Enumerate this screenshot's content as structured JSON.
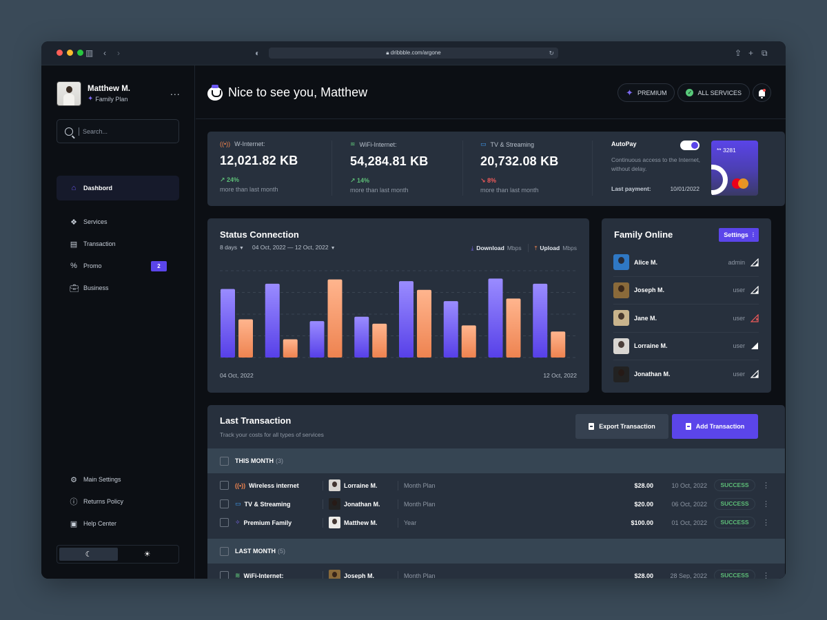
{
  "browser": {
    "url": "dribbble.com/argone",
    "dot_colors": [
      "#ff5f57",
      "#febc2e",
      "#28c840"
    ]
  },
  "sidebar": {
    "profile": {
      "name": "Matthew M.",
      "plan": "Family Plan",
      "more": "..."
    },
    "search": {
      "placeholder": "Search..."
    },
    "nav": [
      {
        "label": "Dashbord",
        "icon": "home-icon",
        "active": true
      },
      {
        "label": "Services",
        "icon": "services-icon"
      },
      {
        "label": "Transaction",
        "icon": "transaction-icon"
      },
      {
        "label": "Promo",
        "icon": "percent-icon",
        "badge": "2"
      },
      {
        "label": "Business",
        "icon": "briefcase-icon"
      }
    ],
    "bottom_nav": [
      {
        "label": "Main Settings",
        "icon": "gear-icon"
      },
      {
        "label": "Returns Policy",
        "icon": "info-icon"
      },
      {
        "label": "Help Center",
        "icon": "help-icon"
      }
    ],
    "theme": {
      "active": "dark"
    }
  },
  "header": {
    "greeting": "Nice to see you, Matthew",
    "premium": "PREMIUM",
    "all_services": "ALL SERVICES"
  },
  "stats": [
    {
      "label": "W-Internet:",
      "value": "12,021.82 KB",
      "change": "24%",
      "direction": "up",
      "sub": "more than last month",
      "icon": "wireless-icon"
    },
    {
      "label": "WiFi-Internet:",
      "value": "54,284.81 KB",
      "change": "14%",
      "direction": "up",
      "sub": "more than last month",
      "icon": "wifi-icon"
    },
    {
      "label": "TV & Streaming",
      "value": "20,732.08 KB",
      "change": "8%",
      "direction": "down",
      "sub": "more than last month",
      "icon": "tv-icon"
    }
  ],
  "autopay": {
    "title": "AutoPay",
    "enabled": true,
    "description": "Continuous access to the Internet, without delay.",
    "last_payment_label": "Last payment:",
    "last_payment_value": "10/01/2022",
    "card_number": "** 3281"
  },
  "status_connection": {
    "title": "Status Connection",
    "period": "8 days",
    "range": "04 Oct, 2022 — 12 Oct, 2022",
    "legend_download": "Download",
    "legend_upload": "Upload",
    "unit": "Mbps"
  },
  "chart_data": {
    "type": "bar",
    "title": "Status Connection",
    "xlabel": "",
    "ylabel": "Mbps",
    "x_start_label": "04 Oct, 2022",
    "x_end_label": "12 Oct, 2022",
    "ylim": [
      0,
      100
    ],
    "grid": true,
    "categories": [
      "1",
      "2",
      "3",
      "4",
      "5",
      "6",
      "7",
      "8"
    ],
    "series": [
      {
        "name": "Download Mbps",
        "color": "#6a57f0",
        "values": [
          79,
          85,
          42,
          47,
          88,
          65,
          91,
          85
        ]
      },
      {
        "name": "Upload Mbps",
        "color": "#f0844f",
        "values": [
          44,
          21,
          90,
          39,
          78,
          37,
          68,
          30
        ]
      }
    ]
  },
  "family": {
    "title": "Family Online",
    "settings_label": "Settings",
    "members": [
      {
        "name": "Alice M.",
        "role": "admin",
        "signal": "partial",
        "avatar_bg": "#2f78c4"
      },
      {
        "name": "Joseph M.",
        "role": "user",
        "signal": "partial",
        "avatar_bg": "#8a6a3a"
      },
      {
        "name": "Jane M.",
        "role": "user",
        "signal": "none",
        "avatar_bg": "#c9b48c"
      },
      {
        "name": "Lorraine M.",
        "role": "user",
        "signal": "full",
        "avatar_bg": "#d9d6d2"
      },
      {
        "name": "Jonathan M.",
        "role": "user",
        "signal": "partial",
        "avatar_bg": "#222222"
      }
    ]
  },
  "transactions": {
    "title": "Last Transaction",
    "subtitle": "Track your costs for all types of services",
    "export_label": "Export Transaction",
    "add_label": "Add Transaction",
    "groups": [
      {
        "label": "THIS MONTH",
        "count": "(3)",
        "rows": [
          {
            "service": "Wireless internet",
            "icon": "wireless-icon",
            "user": "Lorraine M.",
            "avatar_bg": "#d9d6d2",
            "plan": "Month Plan",
            "amount": "$28.00",
            "date": "10 Oct, 2022",
            "status": "SUCCESS"
          },
          {
            "service": "TV & Streaming",
            "icon": "tv-icon",
            "user": "Jonathan M.",
            "avatar_bg": "#222222",
            "plan": "Month Plan",
            "amount": "$20.00",
            "date": "06 Oct, 2022",
            "status": "SUCCESS"
          },
          {
            "service": "Premium Family",
            "icon": "sparkle-icon",
            "user": "Matthew M.",
            "avatar_bg": "#ecebe8",
            "plan": "Year",
            "amount": "$100.00",
            "date": "01 Oct, 2022",
            "status": "SUCCESS"
          }
        ]
      },
      {
        "label": "LAST MONTH",
        "count": "(5)",
        "rows": [
          {
            "service": "WiFi-Internet:",
            "icon": "wifi-icon",
            "user": "Joseph M.",
            "avatar_bg": "#8a6a3a",
            "plan": "Month Plan",
            "amount": "$28.00",
            "date": "28 Sep, 2022",
            "status": "SUCCESS"
          }
        ]
      }
    ]
  }
}
